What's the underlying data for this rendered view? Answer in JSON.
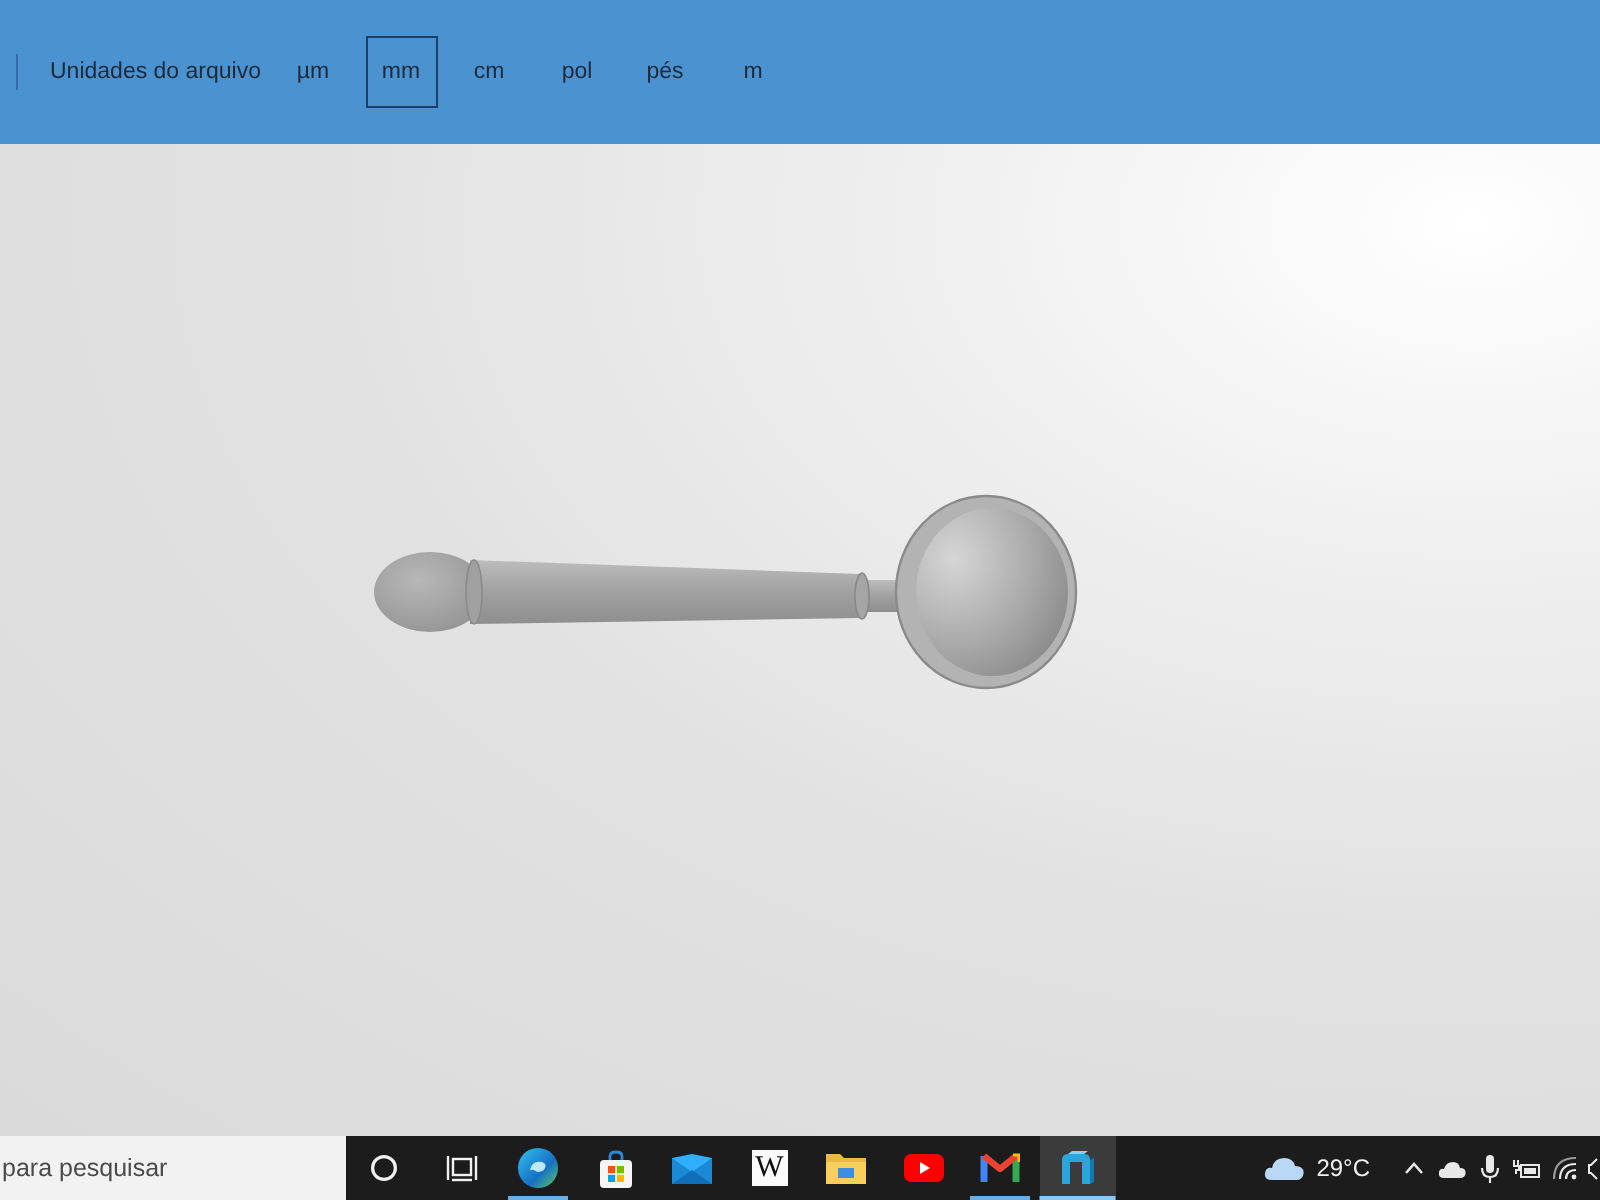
{
  "toolbar": {
    "label": "Unidades do arquivo",
    "units": [
      {
        "label": "µm",
        "selected": false
      },
      {
        "label": "mm",
        "selected": true
      },
      {
        "label": "cm",
        "selected": false
      },
      {
        "label": "pol",
        "selected": false
      },
      {
        "label": "pés",
        "selected": false
      },
      {
        "label": "m",
        "selected": false
      }
    ]
  },
  "taskbar": {
    "search": {
      "placeholder": "para pesquisar"
    },
    "buttons": [
      {
        "kind": "cortana"
      },
      {
        "kind": "task-view"
      }
    ],
    "apps": [
      {
        "kind": "edge",
        "running": true,
        "selected": false
      },
      {
        "kind": "store",
        "running": false,
        "selected": false
      },
      {
        "kind": "mail",
        "running": false,
        "selected": false
      },
      {
        "kind": "wikipedia",
        "letter": "W",
        "running": false,
        "selected": false
      },
      {
        "kind": "explorer",
        "running": false,
        "selected": false
      },
      {
        "kind": "youtube",
        "running": false,
        "selected": false
      },
      {
        "kind": "gmail",
        "running": true,
        "selected": false
      },
      {
        "kind": "viewer",
        "running": true,
        "selected": true
      }
    ],
    "weather": {
      "temperature": "29°C"
    },
    "tray": [
      {
        "kind": "chevron"
      },
      {
        "kind": "onedrive"
      },
      {
        "kind": "microphone"
      },
      {
        "kind": "power"
      },
      {
        "kind": "wifi"
      },
      {
        "kind": "speaker"
      }
    ]
  }
}
